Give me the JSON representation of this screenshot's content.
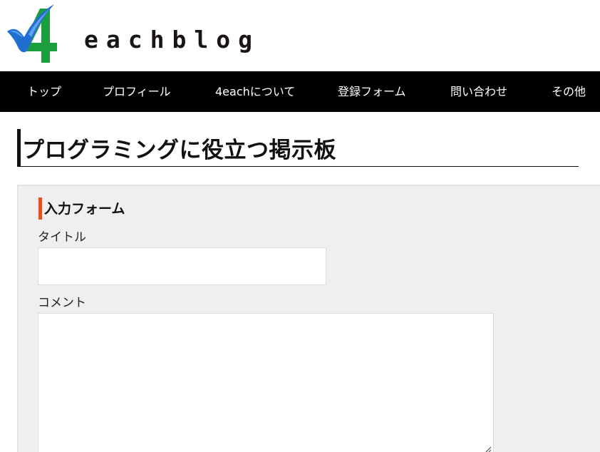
{
  "header": {
    "logo_text": "4",
    "site_name": "eachblog"
  },
  "nav": {
    "items": [
      {
        "label": "トップ"
      },
      {
        "label": "プロフィール"
      },
      {
        "label": "4eachについて"
      },
      {
        "label": "登録フォーム"
      },
      {
        "label": "問い合わせ"
      },
      {
        "label": "その他"
      }
    ]
  },
  "main": {
    "page_title": "プログラミングに役立つ掲示板"
  },
  "form": {
    "heading": "入力フォーム",
    "accent_color": "#e8501a",
    "title_label": "タイトル",
    "title_value": "",
    "comment_label": "コメント",
    "comment_value": ""
  },
  "colors": {
    "nav_background": "#000000",
    "nav_text": "#ffffff",
    "panel_background": "#efefef",
    "logo_blue": "#1f6fd1",
    "logo_green": "#1a9e3f"
  }
}
